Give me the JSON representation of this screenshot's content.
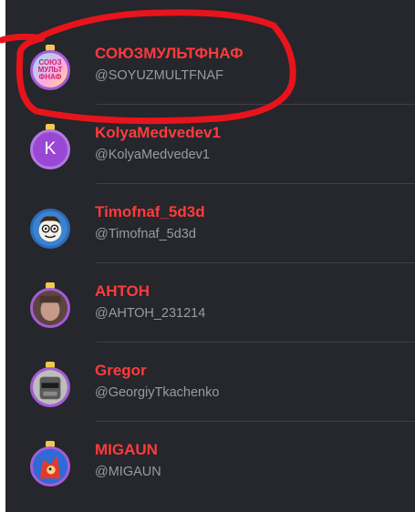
{
  "users": [
    {
      "name": "СОЮЗМУЛЬТФНАФ",
      "handle": "@SOYUZMULTFNAF",
      "avatar_text": "СОЮЗ МУЛЬТ ФНАФ",
      "avatar_icon": "soyuzmultfnaf-logo-avatar"
    },
    {
      "name": "KolyaMedvedev1",
      "handle": "@KolyaMedvedev1",
      "avatar_text": "K",
      "avatar_icon": "letter-avatar"
    },
    {
      "name": "Timofnaf_5d3d",
      "handle": "@Timofnaf_5d3d",
      "avatar_icon": "cartoon-face-avatar"
    },
    {
      "name": "АНТОН",
      "handle": "@АНТОН_231214",
      "avatar_icon": "photo-avatar"
    },
    {
      "name": "Gregor",
      "handle": "@GeorgiyTkachenko",
      "avatar_icon": "robot-avatar"
    },
    {
      "name": "MIGAUN",
      "handle": "@MIGAUN",
      "avatar_icon": "red-character-avatar"
    }
  ],
  "colors": {
    "panel_bg": "#26262d",
    "name": "#ff3b3b",
    "handle": "#9a9aa3",
    "divider": "#3f3f48",
    "avatar_ring": "#a65cd8",
    "crown": "#f2c94c",
    "annotation": "#e8141b"
  }
}
